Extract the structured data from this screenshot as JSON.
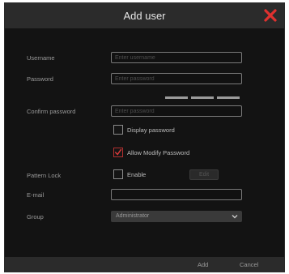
{
  "dialog": {
    "title": "Add user",
    "close_icon": "close-x-icon",
    "accent_color": "#d93a3a"
  },
  "form": {
    "username": {
      "label": "Username",
      "value": "",
      "placeholder": "Enter username"
    },
    "password": {
      "label": "Password",
      "value": "",
      "placeholder": "Enter password"
    },
    "confirm_password": {
      "label": "Confirm password",
      "value": "",
      "placeholder": "Enter password"
    },
    "display_password": {
      "label": "Display password",
      "checked": false
    },
    "allow_modify_password": {
      "label": "Allow Modify Password",
      "checked": true
    },
    "pattern_lock": {
      "label": "Pattern Lock",
      "enable_label": "Enable",
      "enabled": false,
      "edit_label": "Edit"
    },
    "email": {
      "label": "E-mail",
      "value": ""
    },
    "group": {
      "label": "Group",
      "selected": "Administrator"
    }
  },
  "footer": {
    "add_label": "Add",
    "cancel_label": "Cancel"
  }
}
